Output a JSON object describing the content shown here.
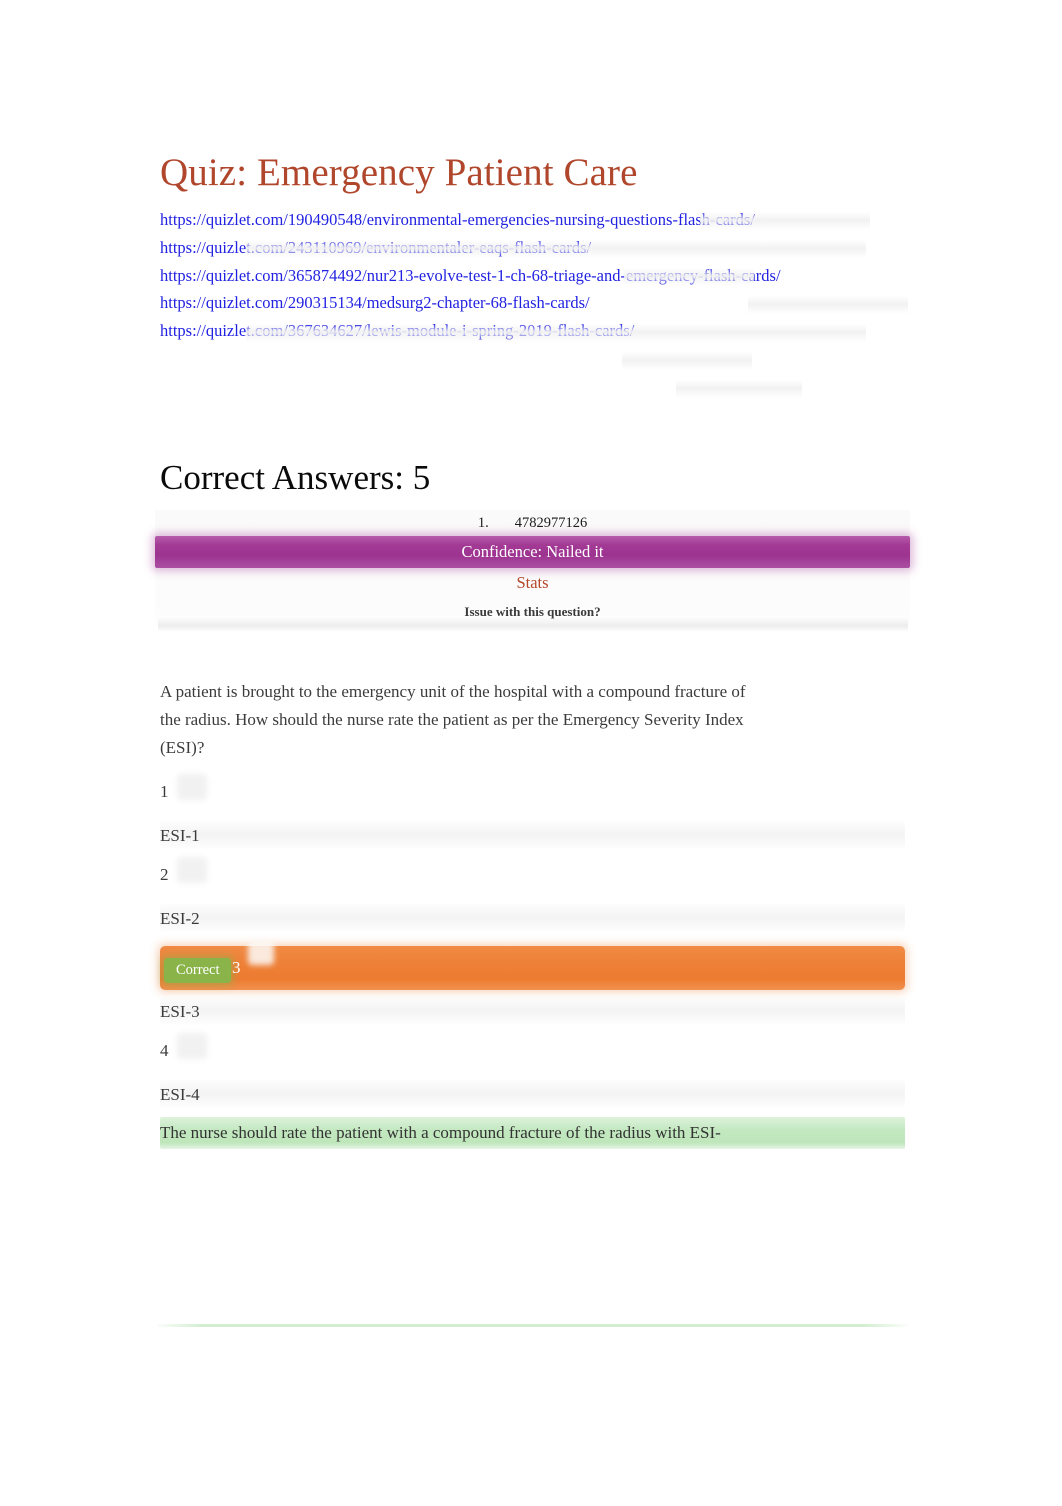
{
  "document": {
    "title": "Quiz: Emergency Patient Care",
    "title_color": "#b0462c",
    "link_color": "#2222e2",
    "section_heading": "Correct Answers: 5"
  },
  "links": [
    {
      "url": "https://quizlet.com/190490548/environmental-emergencies-nursing-questions-flash-cards/"
    },
    {
      "url": "https://quizlet.com/243110969/environmentaler-eaqs-flash-cards/"
    },
    {
      "url": "https://quizlet.com/365874492/nur213-evolve-test-1-ch-68-triage-and-emergency-flash-cards/"
    },
    {
      "url": "https://quizlet.com/290315134/medsurg2-chapter-68-flash-cards/"
    },
    {
      "url": "https://quizlet.com/367634627/lewis-module-i-spring-2019-flash-cards/"
    }
  ],
  "answer_card": {
    "item_index": "1.",
    "item_id": "4782977126",
    "confidence_label": "Confidence: Nailed it",
    "confidence_color": "#9c3390",
    "stats_link": "Stats",
    "stats_color": "#b5472b",
    "issue_link": "Issue with this question?"
  },
  "question": {
    "text": "A patient is brought to the emergency unit of the hospital with a compound fracture of the radius. How should the nurse rate the patient as per the Emergency Severity Index (ESI)?"
  },
  "options": [
    {
      "number": "1",
      "label": "ESI-1",
      "correct": false
    },
    {
      "number": "2",
      "label": "ESI-2",
      "correct": false
    },
    {
      "number": "3",
      "label": "ESI-3",
      "correct": true
    },
    {
      "number": "4",
      "label": "ESI-4",
      "correct": false
    }
  ],
  "correct_marker": {
    "badge": "Correct",
    "value": "3",
    "bar_color": "#ee8037",
    "badge_color": "#8ab44a"
  },
  "rationale": {
    "text": "The nurse should rate the patient with a compound fracture of the radius with ESI-",
    "highlight_color": "#c3e8c0"
  }
}
